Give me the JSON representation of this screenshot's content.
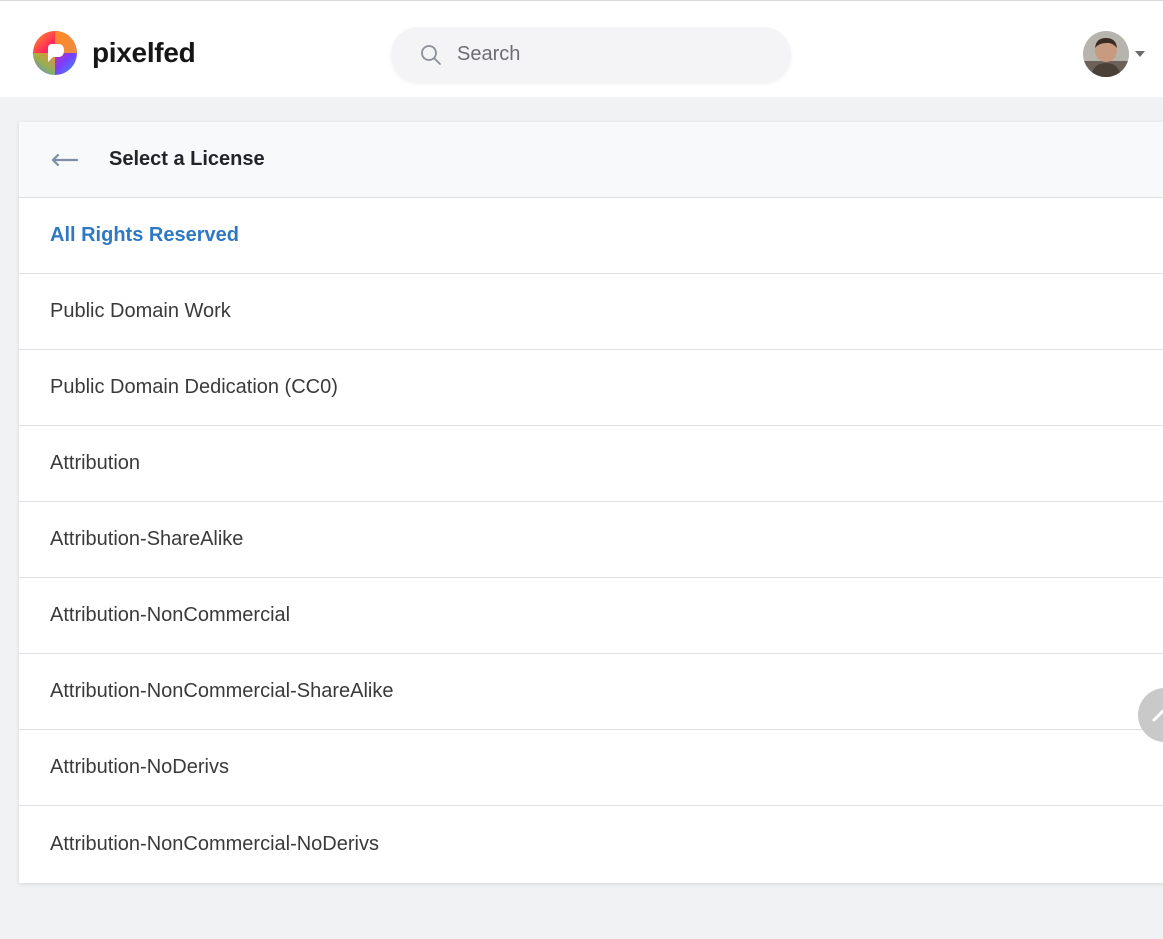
{
  "app": {
    "name": "pixelfed",
    "brand_colors": [
      "#ff2a5a",
      "#ff9a1f",
      "#8ccf3e",
      "#2f9ef0",
      "#7c3cff"
    ]
  },
  "search": {
    "placeholder": "Search",
    "value": ""
  },
  "account": {
    "avatar_icon": "user-avatar",
    "caret_icon": "caret-down-icon"
  },
  "license_picker": {
    "back_icon": "back-arrow-icon",
    "title": "Select a License",
    "selected_index": 0,
    "selected_color": "#2f79c4",
    "options": [
      "All Rights Reserved",
      "Public Domain Work",
      "Public Domain Dedication (CC0)",
      "Attribution",
      "Attribution-ShareAlike",
      "Attribution-NonCommercial",
      "Attribution-NonCommercial-ShareAlike",
      "Attribution-NoDerivs",
      "Attribution-NonCommercial-NoDerivs"
    ]
  },
  "scroll_top_icon": "chevron-up-icon"
}
